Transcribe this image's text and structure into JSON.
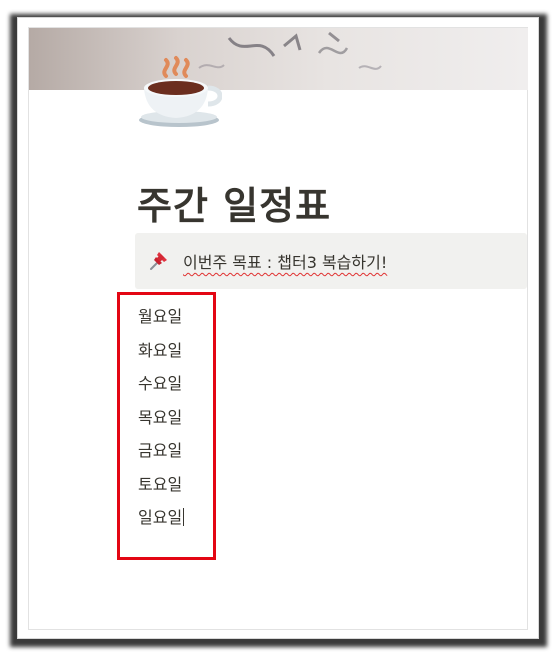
{
  "page": {
    "icon": "hot-beverage-icon",
    "title": "주간 일정표"
  },
  "callout": {
    "icon": "pushpin-icon",
    "text": "이번주 목표 : 챕터3 복습하기!"
  },
  "days": [
    "월요일",
    "화요일",
    "수요일",
    "목요일",
    "금요일",
    "토요일",
    "일요일"
  ],
  "colors": {
    "text": "#37352f",
    "callout_bg": "#f1f1ef",
    "highlight": "#e30613"
  }
}
